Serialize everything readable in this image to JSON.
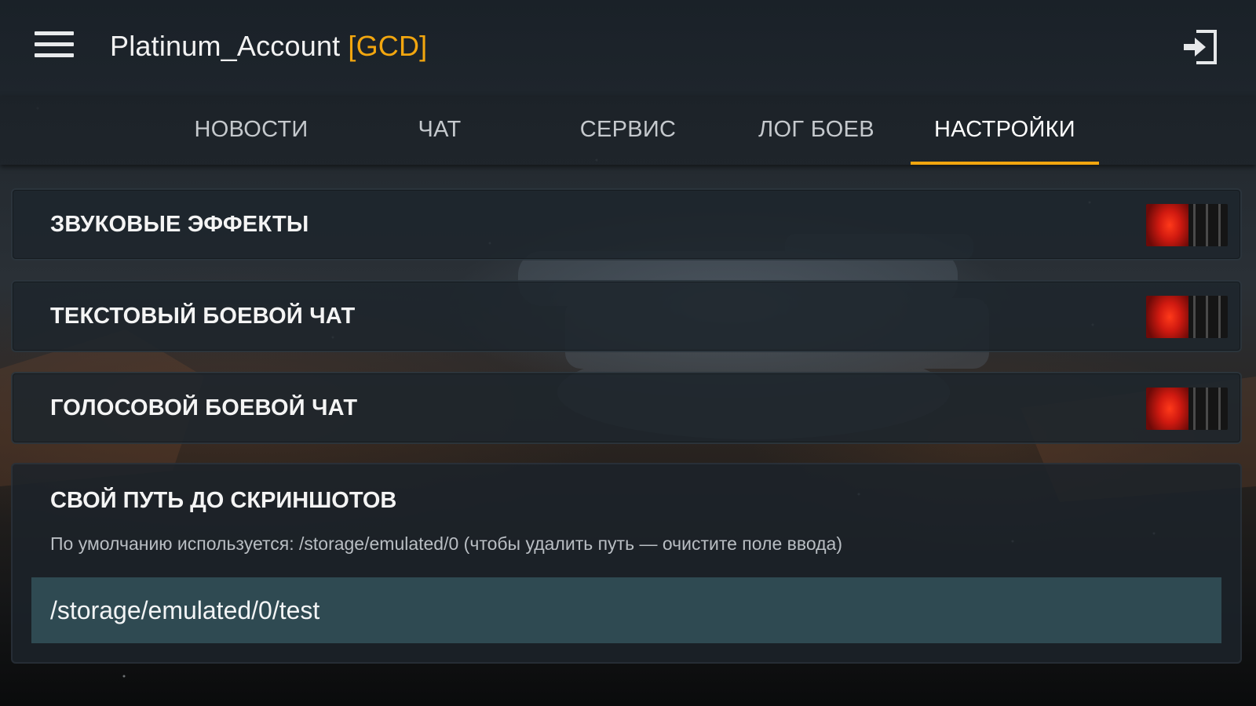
{
  "header": {
    "menu_icon": "hamburger-menu-icon",
    "account_name": "Platinum_Account",
    "clan_tag": "[GCD]",
    "clan_tag_color": "#f2a60f",
    "logout_icon": "logout-icon"
  },
  "tabs": [
    {
      "label": "НОВОСТИ",
      "active": false
    },
    {
      "label": "ЧАТ",
      "active": false
    },
    {
      "label": "СЕРВИС",
      "active": false
    },
    {
      "label": "ЛОГ БОЕВ",
      "active": false
    },
    {
      "label": "НАСТРОЙКИ",
      "active": true
    }
  ],
  "accent_color": "#f2a60f",
  "settings": [
    {
      "label": "ЗВУКОВЫЕ ЭФФЕКТЫ",
      "toggle_state": "on"
    },
    {
      "label": "ТЕКСТОВЫЙ БОЕВОЙ ЧАТ",
      "toggle_state": "on"
    },
    {
      "label": "ГОЛОСОВОЙ БОЕВОЙ ЧАТ",
      "toggle_state": "on"
    }
  ],
  "screenshot_path": {
    "title": "СВОЙ ПУТЬ ДО СКРИНШОТОВ",
    "hint": "По умолчанию используется: /storage/emulated/0 (чтобы удалить путь — очистите поле ввода)",
    "value": "/storage/emulated/0/test"
  }
}
